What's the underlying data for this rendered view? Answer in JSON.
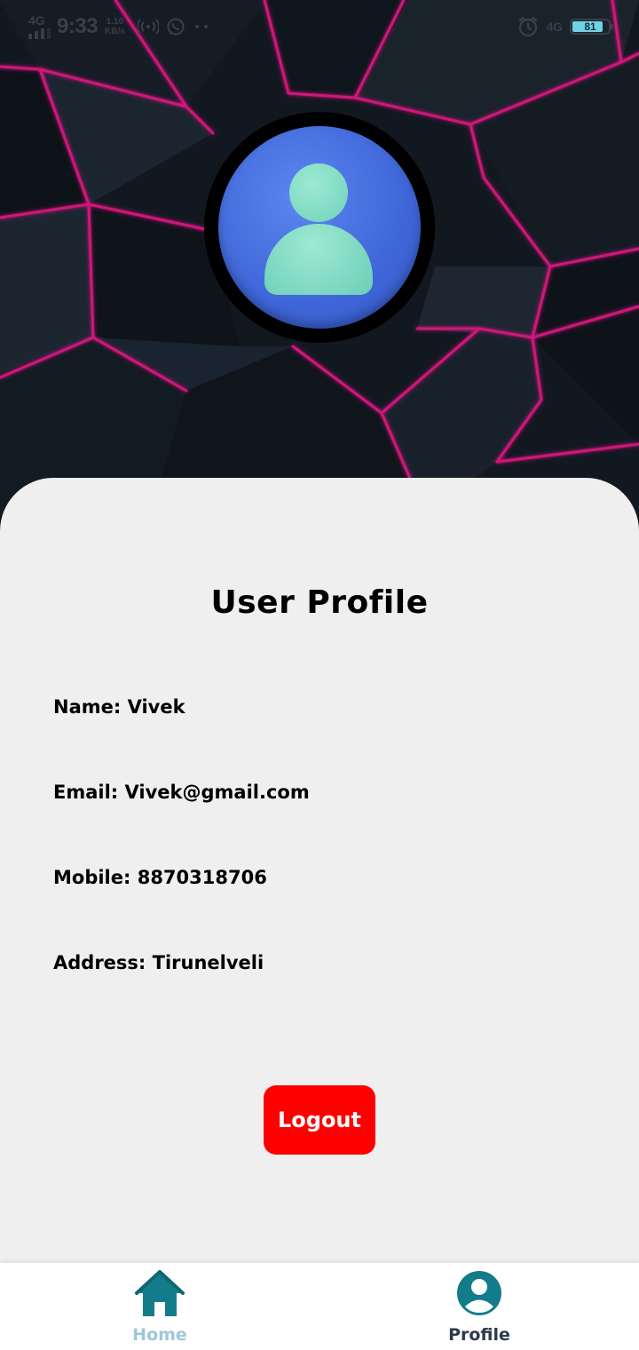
{
  "status_bar": {
    "network_left": "4G",
    "time": "9:33",
    "speed_value": "1.10",
    "speed_unit": "KB/s",
    "network_right": "4G",
    "battery": "81",
    "icons": [
      "signal-bars-icon",
      "hotspot-icon",
      "whatsapp-icon",
      "more-dots-icon",
      "alarm-icon"
    ]
  },
  "profile": {
    "title": "User Profile",
    "name_line": "Name: Vivek",
    "email_line": "Email: Vivek@gmail.com",
    "mobile_line": "Mobile: 8870318706",
    "address_line": "Address: Tirunelveli"
  },
  "actions": {
    "logout_label": "Logout"
  },
  "bottom_nav": {
    "items": [
      {
        "label": "Home",
        "icon": "home-icon",
        "active": false
      },
      {
        "label": "Profile",
        "icon": "profile-icon",
        "active": true
      }
    ]
  },
  "colors": {
    "accent_teal": "#137c8b",
    "logout_red": "#ff0000",
    "card_bg": "#efefef",
    "hero_line_magenta": "#d0157a",
    "avatar_blue": "#3f66d8",
    "avatar_mint": "#7ad9c2"
  }
}
